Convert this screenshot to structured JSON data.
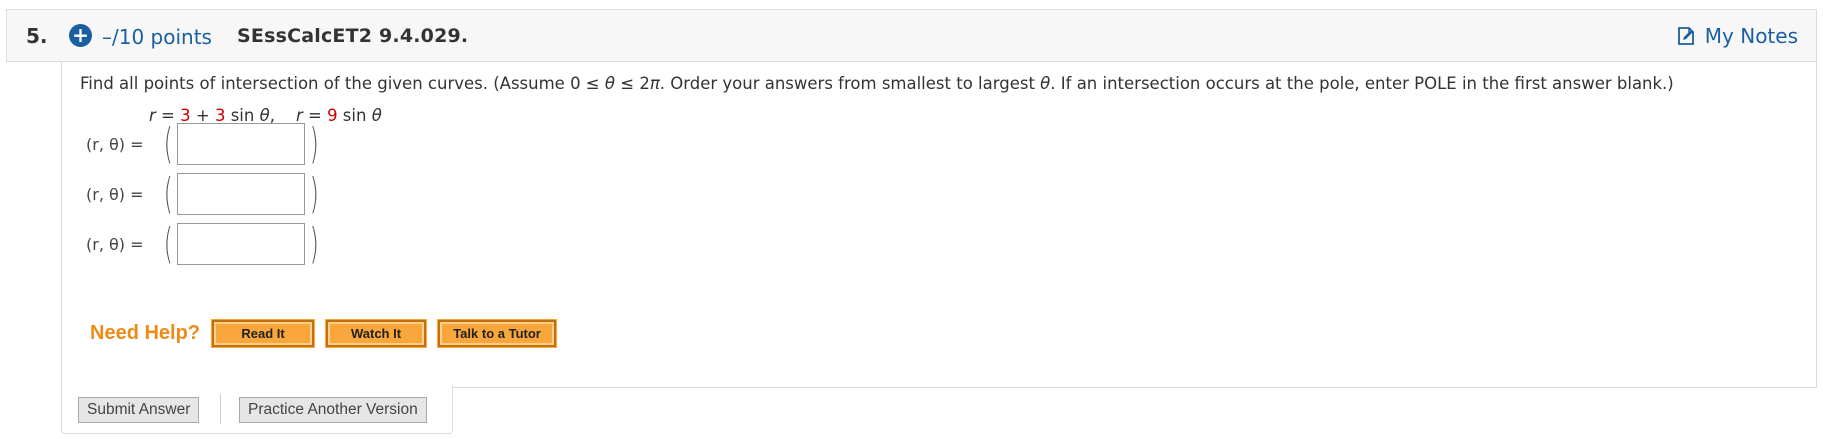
{
  "question": {
    "number": "5.",
    "points": "–/10 points",
    "id": "SEssCalcET2 9.4.029.",
    "my_notes": "My Notes",
    "prompt_parts": {
      "before": "Find all points of intersection of the given curves. (Assume  0 ≤ ",
      "theta1": "θ",
      "mid1": " ≤ 2",
      "pi": "π",
      "after": ".  Order your answers from smallest to largest ",
      "theta2": "θ",
      "end": ". If an intersection occurs at the pole, enter POLE in the first answer blank.)"
    },
    "equation": {
      "r1": "r",
      "eq1_prefix": " = ",
      "c1": "3",
      "plus": " + ",
      "c2": "3",
      "sin1": " sin ",
      "theta_a": "θ",
      "sep": ",    ",
      "r2": "r",
      "eq2_prefix": " = ",
      "c3": "9",
      "sin2": " sin ",
      "theta_b": "θ"
    },
    "answer_rows": [
      {
        "label": "(r, θ)  =",
        "value": ""
      },
      {
        "label": "(r, θ)  =",
        "value": ""
      },
      {
        "label": "(r, θ)  =",
        "value": ""
      }
    ],
    "help": {
      "label": "Need Help?",
      "read_it": "Read It",
      "watch_it": "Watch It",
      "talk_tutor": "Talk to a Tutor"
    },
    "footer": {
      "submit": "Submit Answer",
      "practice": "Practice Another Version"
    }
  },
  "colors": {
    "link_blue": "#1a5fa0",
    "coefficient_red": "#cc0000",
    "help_orange": "#ef8a17",
    "help_button": "#f9a73c"
  },
  "icons": {
    "points": "plus-circle-icon",
    "notes": "note-icon"
  }
}
